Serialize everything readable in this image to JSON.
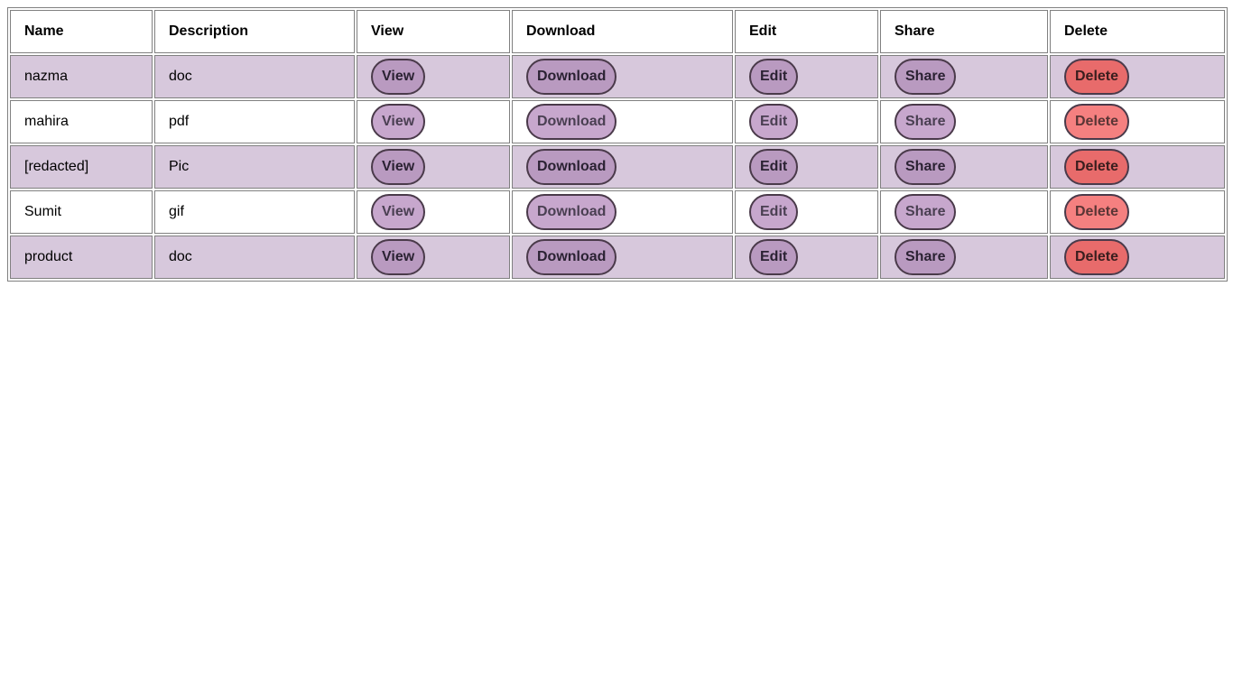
{
  "colors": {
    "row_odd": "#d7c8dc",
    "row_even": "#ffffff",
    "button_odd": "#b99ac0",
    "button_even": "#c7a7cd",
    "delete_odd": "#e86b6b",
    "delete_even": "#f58080",
    "border": "#808080"
  },
  "table": {
    "headers": [
      "Name",
      "Description",
      "View",
      "Download",
      "Edit",
      "Share",
      "Delete"
    ],
    "rows": [
      {
        "name": "nazma",
        "description": "doc"
      },
      {
        "name": "mahira",
        "description": "pdf"
      },
      {
        "name": "[redacted]",
        "description": "Pic"
      },
      {
        "name": "Sumit",
        "description": "gif"
      },
      {
        "name": "product",
        "description": "doc"
      }
    ],
    "actions": {
      "view": "View",
      "download": "Download",
      "edit": "Edit",
      "share": "Share",
      "delete": "Delete"
    }
  }
}
